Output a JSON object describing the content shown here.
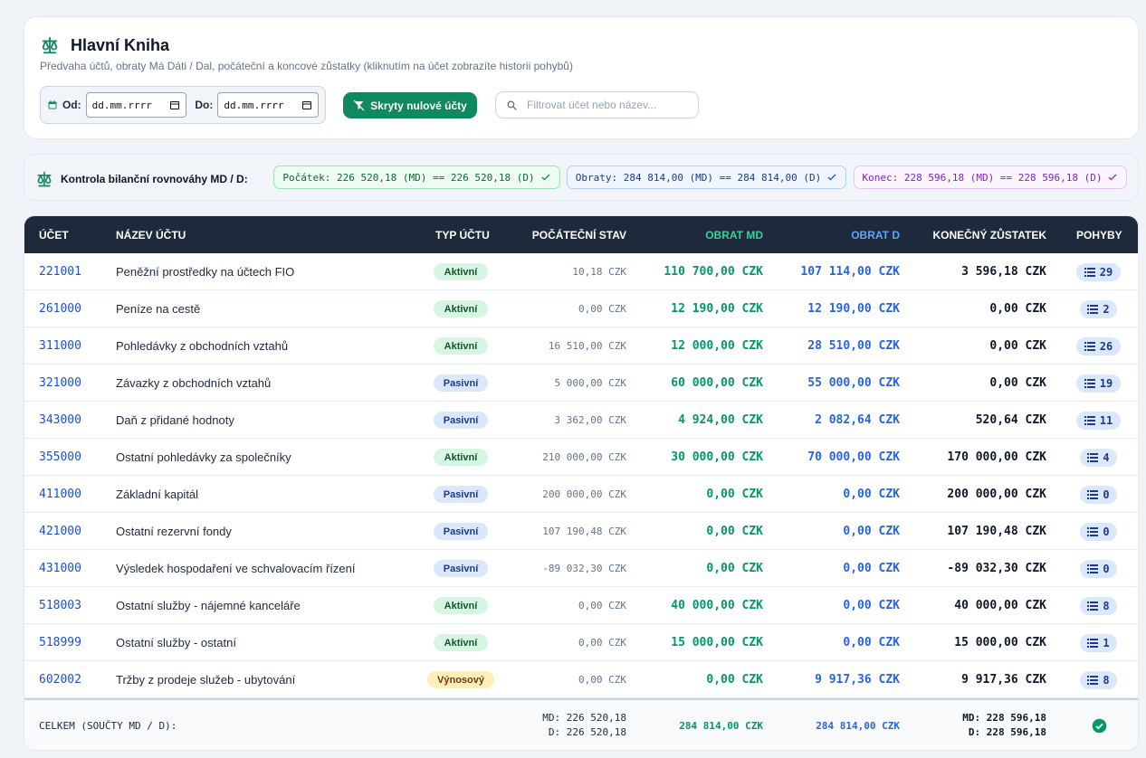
{
  "header": {
    "title": "Hlavní Kniha",
    "subtitle": "Předvaha účtů, obraty Má Dáti / Dal, počáteční a koncové zůstatky (kliknutím na účet zobrazíte historii pohybů)",
    "from_label": "Od:",
    "to_label": "Do:",
    "date_placeholder": "dd.mm.rrrr",
    "toggle_button": "Skryty nulové účty",
    "search_placeholder": "Filtrovat účet nebo název..."
  },
  "balance_check": {
    "label": "Kontrola bilanční rovnováhy MD / D:",
    "start": "Počátek: 226 520,18 (MD) == 226 520,18 (D)",
    "turnover": "Obraty: 284 814,00 (MD) == 284 814,00 (D)",
    "end": "Konec: 228 596,18 (MD) == 228 596,18 (D)"
  },
  "table": {
    "headers": {
      "account": "ÚČET",
      "name": "NÁZEV ÚČTU",
      "type": "TYP ÚČTU",
      "opening": "POČÁTEČNÍ STAV",
      "md": "OBRAT MD",
      "d": "OBRAT D",
      "closing": "KONEČNÝ ZŮSTATEK",
      "movements": "POHYBY"
    },
    "rows": [
      {
        "account": "221001",
        "name": "Peněžní prostředky na účtech FIO",
        "type": "Aktivní",
        "opening": "10,18 CZK",
        "md": "110 700,00 CZK",
        "d": "107 114,00 CZK",
        "closing": "3 596,18 CZK",
        "movements": "29"
      },
      {
        "account": "261000",
        "name": "Peníze na cestě",
        "type": "Aktivní",
        "opening": "0,00 CZK",
        "md": "12 190,00 CZK",
        "d": "12 190,00 CZK",
        "closing": "0,00 CZK",
        "movements": "2"
      },
      {
        "account": "311000",
        "name": "Pohledávky z obchodních vztahů",
        "type": "Aktivní",
        "opening": "16 510,00 CZK",
        "md": "12 000,00 CZK",
        "d": "28 510,00 CZK",
        "closing": "0,00 CZK",
        "movements": "26"
      },
      {
        "account": "321000",
        "name": "Závazky z obchodních vztahů",
        "type": "Pasivní",
        "opening": "5 000,00 CZK",
        "md": "60 000,00 CZK",
        "d": "55 000,00 CZK",
        "closing": "0,00 CZK",
        "movements": "19"
      },
      {
        "account": "343000",
        "name": "Daň z přidané hodnoty",
        "type": "Pasivní",
        "opening": "3 362,00 CZK",
        "md": "4 924,00 CZK",
        "d": "2 082,64 CZK",
        "closing": "520,64 CZK",
        "movements": "11"
      },
      {
        "account": "355000",
        "name": "Ostatní pohledávky za společníky",
        "type": "Aktivní",
        "opening": "210 000,00 CZK",
        "md": "30 000,00 CZK",
        "d": "70 000,00 CZK",
        "closing": "170 000,00 CZK",
        "movements": "4"
      },
      {
        "account": "411000",
        "name": "Základní kapitál",
        "type": "Pasivní",
        "opening": "200 000,00 CZK",
        "md": "0,00 CZK",
        "d": "0,00 CZK",
        "closing": "200 000,00 CZK",
        "movements": "0"
      },
      {
        "account": "421000",
        "name": "Ostatní rezervní fondy",
        "type": "Pasivní",
        "opening": "107 190,48 CZK",
        "md": "0,00 CZK",
        "d": "0,00 CZK",
        "closing": "107 190,48 CZK",
        "movements": "0"
      },
      {
        "account": "431000",
        "name": "Výsledek hospodaření ve schvalovacím řízení",
        "type": "Pasivní",
        "opening": "-89 032,30 CZK",
        "md": "0,00 CZK",
        "d": "0,00 CZK",
        "closing": "-89 032,30 CZK",
        "movements": "0"
      },
      {
        "account": "518003",
        "name": "Ostatní služby - nájemné kanceláře",
        "type": "Aktivní",
        "opening": "0,00 CZK",
        "md": "40 000,00 CZK",
        "d": "0,00 CZK",
        "closing": "40 000,00 CZK",
        "movements": "8"
      },
      {
        "account": "518999",
        "name": "Ostatní služby - ostatní",
        "type": "Aktivní",
        "opening": "0,00 CZK",
        "md": "15 000,00 CZK",
        "d": "0,00 CZK",
        "closing": "15 000,00 CZK",
        "movements": "1"
      },
      {
        "account": "602002",
        "name": "Tržby z prodeje služeb - ubytování",
        "type": "Výnosový",
        "opening": "0,00 CZK",
        "md": "0,00 CZK",
        "d": "9 917,36 CZK",
        "closing": "9 917,36 CZK",
        "movements": "8"
      }
    ],
    "footer": {
      "label": "CELKEM (SOUČTY MD / D):",
      "opening_md": "MD: 226 520,18",
      "opening_d": "D: 226 520,18",
      "md_total": "284 814,00 CZK",
      "d_total": "284 814,00 CZK",
      "closing_md": "MD: 228 596,18",
      "closing_d": "D: 228 596,18"
    }
  },
  "colors": {
    "accent_green": "#0f8a5f",
    "table_header_bg": "#1e2a3b",
    "md_color": "#059669",
    "d_color": "#2563eb",
    "account_link": "#1d4ed8"
  },
  "icons": {
    "title": "scale-icon",
    "calendar": "calendar-icon",
    "filter": "filter-off-icon",
    "search": "search-icon",
    "check": "check-icon",
    "list": "list-icon",
    "ok": "check-circle-icon"
  }
}
